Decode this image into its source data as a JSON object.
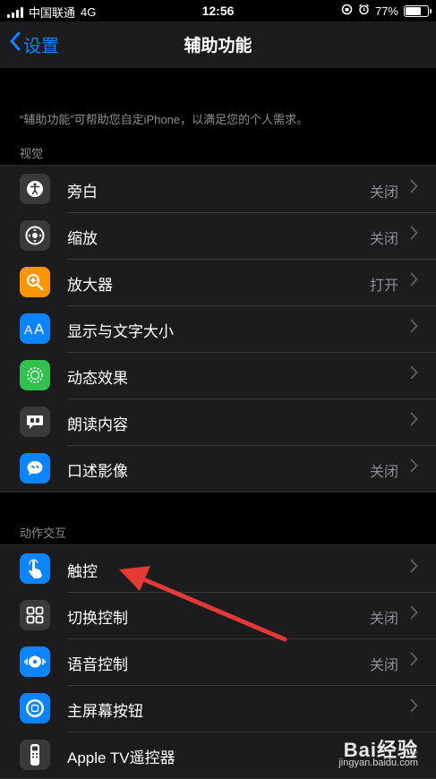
{
  "status_bar": {
    "carrier": "中国联通",
    "network": "4G",
    "time": "12:56",
    "battery": "77%",
    "battery_level": 0.77
  },
  "nav": {
    "back_label": "设置",
    "title": "辅助功能"
  },
  "description": "“辅助功能”可帮助您自定iPhone，以满足您的个人需求。",
  "sections": [
    {
      "header": "视觉",
      "items": [
        {
          "label": "旁白",
          "value": "关闭",
          "icon": "voiceover-icon",
          "color": "#3a3a3c"
        },
        {
          "label": "缩放",
          "value": "关闭",
          "icon": "zoom-icon",
          "color": "#3a3a3c"
        },
        {
          "label": "放大器",
          "value": "打开",
          "icon": "magnifier-icon",
          "color": "#ff9500"
        },
        {
          "label": "显示与文字大小",
          "value": "",
          "icon": "text-size-icon",
          "color": "#0a84ff"
        },
        {
          "label": "动态效果",
          "value": "",
          "icon": "motion-icon",
          "color": "#30c14e"
        },
        {
          "label": "朗读内容",
          "value": "",
          "icon": "spoken-content-icon",
          "color": "#3a3a3c"
        },
        {
          "label": "口述影像",
          "value": "关闭",
          "icon": "audio-description-icon",
          "color": "#0a84ff"
        }
      ]
    },
    {
      "header": "动作交互",
      "items": [
        {
          "label": "触控",
          "value": "",
          "icon": "touch-icon",
          "color": "#0a84ff"
        },
        {
          "label": "切换控制",
          "value": "关闭",
          "icon": "switch-control-icon",
          "color": "#3a3a3c"
        },
        {
          "label": "语音控制",
          "value": "关闭",
          "icon": "voice-control-icon",
          "color": "#0a84ff"
        },
        {
          "label": "主屏幕按钮",
          "value": "",
          "icon": "home-button-icon",
          "color": "#0a84ff"
        },
        {
          "label": "Apple TV遥控器",
          "value": "",
          "icon": "apple-tv-remote-icon",
          "color": "#3a3a3c"
        }
      ]
    }
  ],
  "watermark": {
    "brand": "Bai经验",
    "url": "jingyan.baidu.com"
  }
}
